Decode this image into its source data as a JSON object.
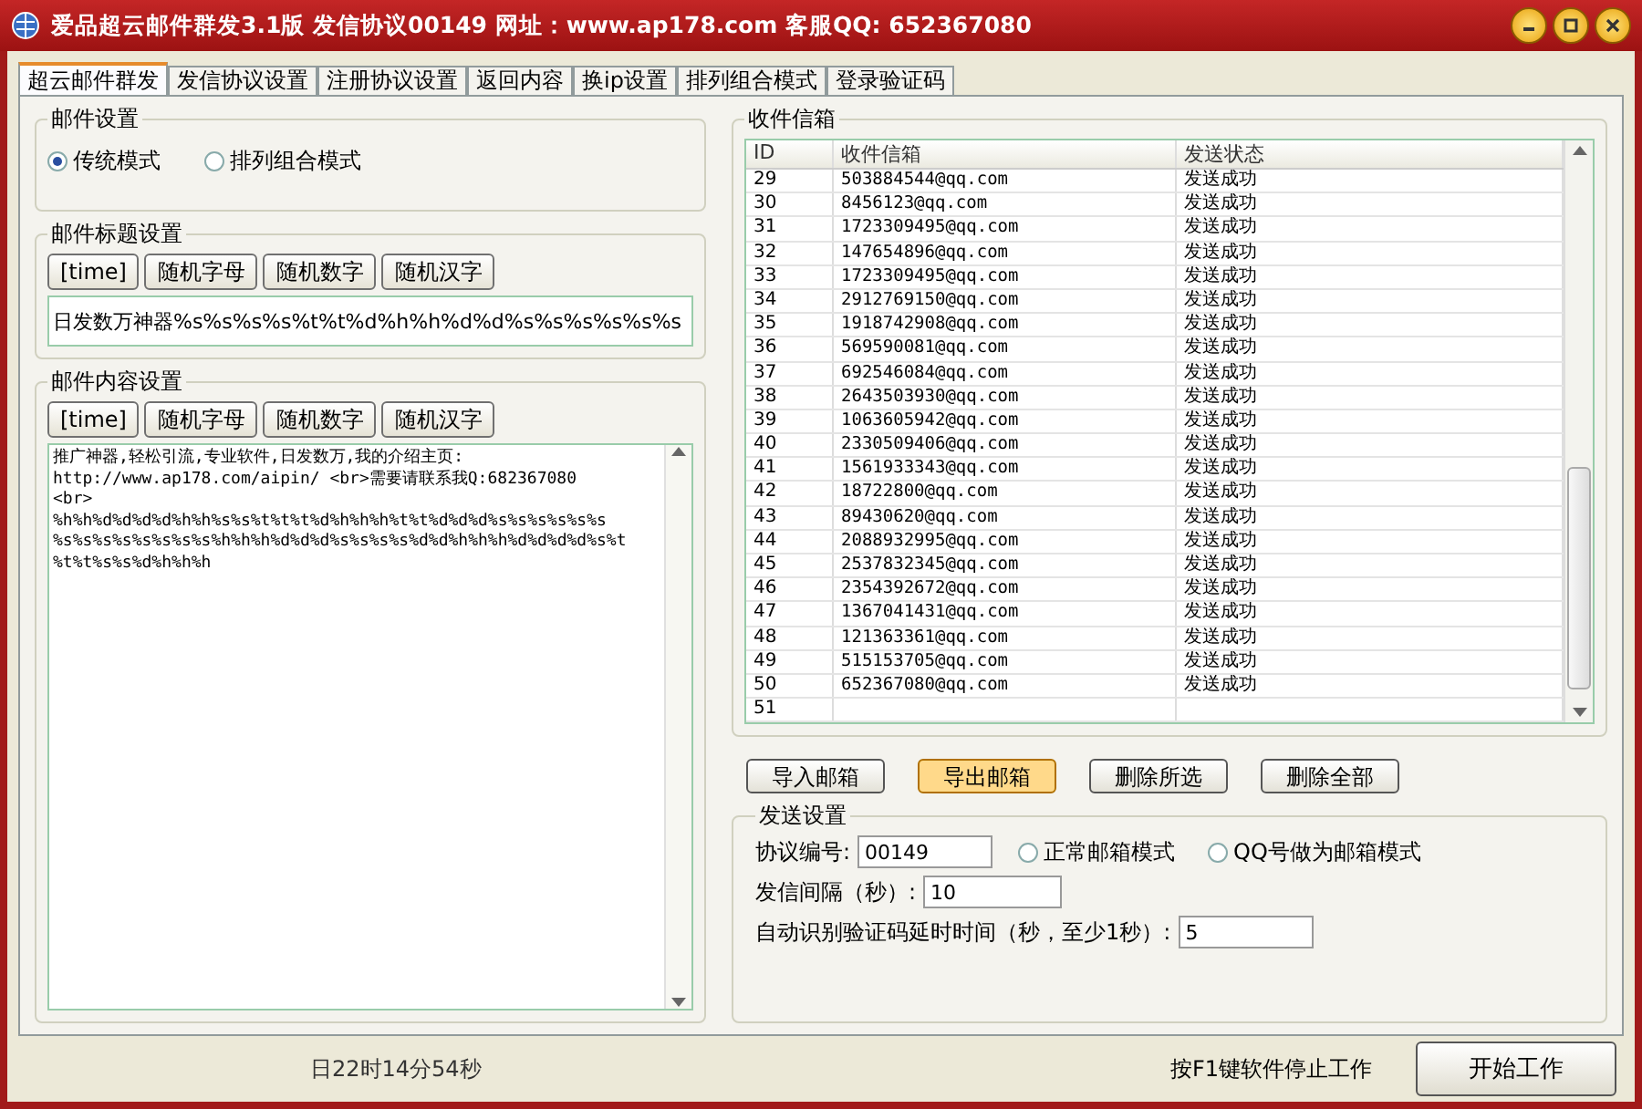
{
  "window": {
    "title": "爱品超云邮件群发3.1版  发信协议00149 网址：www.ap178.com 客服QQ: 652367080"
  },
  "tabs": [
    {
      "label": "超云邮件群发",
      "selected": true
    },
    {
      "label": "发信协议设置",
      "selected": false
    },
    {
      "label": "注册协议设置",
      "selected": false
    },
    {
      "label": "返回内容",
      "selected": false
    },
    {
      "label": "换ip设置",
      "selected": false
    },
    {
      "label": "排列组合模式",
      "selected": false
    },
    {
      "label": "登录验证码",
      "selected": false
    }
  ],
  "mail_settings": {
    "title": "邮件设置",
    "modes": [
      {
        "label": "传统模式",
        "selected": true
      },
      {
        "label": "排列组合模式",
        "selected": false
      }
    ]
  },
  "subject_settings": {
    "title": "邮件标题设置",
    "buttons": [
      "[time]",
      "随机字母",
      "随机数字",
      "随机汉字"
    ],
    "value": "日发数万神器%s%s%s%s%t%t%d%h%h%d%d%s%s%s%s%s%s"
  },
  "content_settings": {
    "title": "邮件内容设置",
    "buttons": [
      "[time]",
      "随机字母",
      "随机数字",
      "随机汉字"
    ],
    "value": "推广神器,轻松引流,专业软件,日发数万,我的介绍主页:\nhttp://www.ap178.com/aipin/ <br>需要请联系我Q:682367080\n<br>\n%h%h%d%d%d%d%h%h%s%s%t%t%t%d%h%h%h%t%t%d%d%d%s%s%s%s%s%s\n%s%s%s%s%s%s%s%s%h%h%h%d%d%d%s%s%s%s%d%d%h%h%h%d%d%d%d%s%t\n%t%t%s%s%d%h%h%h"
  },
  "inbox": {
    "title": "收件信箱",
    "columns": [
      "ID",
      "收件信箱",
      "发送状态"
    ],
    "rows": [
      {
        "id": "29",
        "email": "503884544@qq.com",
        "status": "发送成功"
      },
      {
        "id": "30",
        "email": "8456123@qq.com",
        "status": "发送成功"
      },
      {
        "id": "31",
        "email": "1723309495@qq.com",
        "status": "发送成功"
      },
      {
        "id": "32",
        "email": "147654896@qq.com",
        "status": "发送成功"
      },
      {
        "id": "33",
        "email": "1723309495@qq.com",
        "status": "发送成功"
      },
      {
        "id": "34",
        "email": "2912769150@qq.com",
        "status": "发送成功"
      },
      {
        "id": "35",
        "email": "1918742908@qq.com",
        "status": "发送成功"
      },
      {
        "id": "36",
        "email": "569590081@qq.com",
        "status": "发送成功"
      },
      {
        "id": "37",
        "email": "692546084@qq.com",
        "status": "发送成功"
      },
      {
        "id": "38",
        "email": "2643503930@qq.com",
        "status": "发送成功"
      },
      {
        "id": "39",
        "email": "1063605942@qq.com",
        "status": "发送成功"
      },
      {
        "id": "40",
        "email": "2330509406@qq.com",
        "status": "发送成功"
      },
      {
        "id": "41",
        "email": "1561933343@qq.com",
        "status": "发送成功"
      },
      {
        "id": "42",
        "email": "18722800@qq.com",
        "status": "发送成功"
      },
      {
        "id": "43",
        "email": "89430620@qq.com",
        "status": "发送成功"
      },
      {
        "id": "44",
        "email": "2088932995@qq.com",
        "status": "发送成功"
      },
      {
        "id": "45",
        "email": "2537832345@qq.com",
        "status": "发送成功"
      },
      {
        "id": "46",
        "email": "2354392672@qq.com",
        "status": "发送成功"
      },
      {
        "id": "47",
        "email": "1367041431@qq.com",
        "status": "发送成功"
      },
      {
        "id": "48",
        "email": "121363361@qq.com",
        "status": "发送成功"
      },
      {
        "id": "49",
        "email": "515153705@qq.com",
        "status": "发送成功"
      },
      {
        "id": "50",
        "email": "652367080@qq.com",
        "status": "发送成功"
      },
      {
        "id": "51"
      }
    ]
  },
  "list_buttons": [
    {
      "label": "导入邮箱",
      "focused": false
    },
    {
      "label": "导出邮箱",
      "focused": true
    },
    {
      "label": "删除所选",
      "focused": false
    },
    {
      "label": "删除全部",
      "focused": false
    }
  ],
  "send_settings": {
    "title": "发送设置",
    "protocol_label": "协议编号:",
    "protocol_value": "00149",
    "modes": [
      {
        "label": "正常邮箱模式",
        "selected": false
      },
      {
        "label": "QQ号做为邮箱模式",
        "selected": false
      }
    ],
    "interval_label": "发信间隔（秒）:",
    "interval_value": "10",
    "delay_label": "自动识别验证码延时时间（秒，至少1秒）:",
    "delay_value": "5"
  },
  "status_bar": {
    "time_text": "日22时14分54秒",
    "hint": "按F1键软件停止工作",
    "start_button": "开始工作"
  }
}
